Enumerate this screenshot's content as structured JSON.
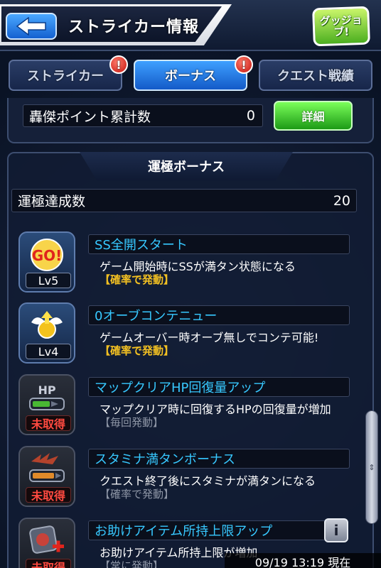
{
  "header": {
    "title": "ストライカー情報",
    "back_icon": "back-arrow-icon",
    "goodjob_label": "グッジョブ!"
  },
  "tabs": [
    {
      "label": "ストライカー",
      "active": false,
      "alert": "!"
    },
    {
      "label": "ボーナス",
      "active": true,
      "alert": "!"
    },
    {
      "label": "クエスト戦績",
      "active": false,
      "alert": ""
    }
  ],
  "points": {
    "label": "轟傑ポイント累計数",
    "value": "0",
    "detail_button": "詳細"
  },
  "section": {
    "title": "運極ボーナス",
    "count_label": "運極達成数",
    "count_value": "20"
  },
  "bonuses": [
    {
      "name": "SS全開スタート",
      "desc": "ゲーム開始時にSSが満タン状態になる",
      "activation": "【確率で発動】",
      "level": "Lv5",
      "icon": "go-icon",
      "acquired": true
    },
    {
      "name": "0オーブコンテニュー",
      "desc": "ゲームオーバー時オーブ無しでコンテ可能!",
      "activation": "【確率で発動】",
      "level": "Lv4",
      "icon": "winged-orb-icon",
      "acquired": true
    },
    {
      "name": "マップクリアHP回復量アップ",
      "desc": "マップクリア時に回復するHPの回復量が増加",
      "activation": "【毎回発動】",
      "level": "未取得",
      "icon": "hp-gauge-icon",
      "acquired": false
    },
    {
      "name": "スタミナ満タンボーナス",
      "desc": "クエスト終了後にスタミナが満タンになる",
      "activation": "【確率で発動】",
      "level": "未取得",
      "icon": "stamina-gauge-icon",
      "acquired": false
    },
    {
      "name": "お助けアイテム所持上限アップ",
      "desc": "お助けアイテム所持上限が増加",
      "activation": "【常に発動】",
      "level": "未取得",
      "icon": "item-plus-icon",
      "acquired": false
    }
  ],
  "info_button": "i",
  "timestamp": "09/19 13:19 現在",
  "colors": {
    "accent": "#37c8ff",
    "activation": "#f2c022",
    "missing": "#ff4a40",
    "good_button": "#1c9a16"
  }
}
